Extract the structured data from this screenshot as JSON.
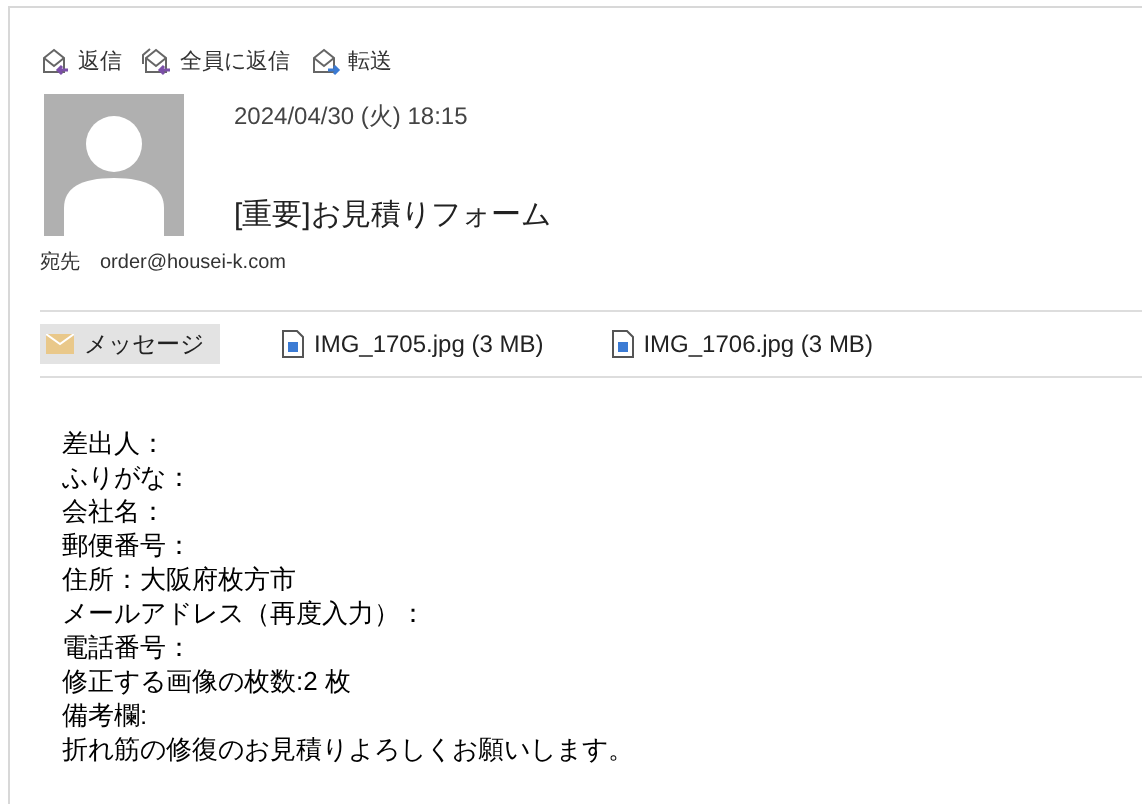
{
  "toolbar": [
    {
      "kind": "reply",
      "label": "返信"
    },
    {
      "kind": "reply_all",
      "label": "全員に返信"
    },
    {
      "kind": "forward",
      "label": "転送"
    }
  ],
  "header": {
    "date": "2024/04/30 (火) 18:15",
    "subject": "[重要]お見積りフォーム",
    "to_label": "宛先",
    "to": "order@housei-k.com"
  },
  "attachments": [
    {
      "kind": "message",
      "label": "メッセージ",
      "selected": true
    },
    {
      "kind": "file",
      "label": "IMG_1705.jpg (3 MB)",
      "selected": false
    },
    {
      "kind": "file",
      "label": "IMG_1706.jpg (3 MB)",
      "selected": false
    }
  ],
  "body": [
    "差出人：",
    "ふりがな：",
    "会社名：",
    "郵便番号：",
    "住所：大阪府枚方市",
    "メールアドレス（再度入力）：",
    "電話番号：",
    "修正する画像の枚数:2 枚",
    "備考欄:",
    "折れ筋の修復のお見積りよろしくお願いします。"
  ]
}
